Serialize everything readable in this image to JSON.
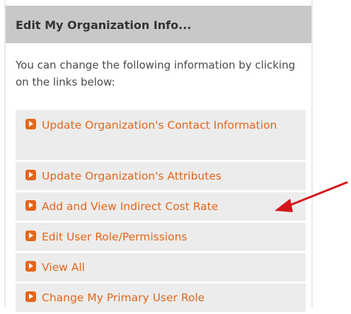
{
  "panel": {
    "title": "Edit My Organization Info...",
    "intro": "You can change the following information by clicking on the links below:"
  },
  "links": [
    {
      "label": "Update Organization's Contact Information",
      "icon": "orange-arrow-bullet-icon"
    },
    {
      "label": "Update Organization's Attributes",
      "icon": "orange-arrow-bullet-icon"
    },
    {
      "label": "Add and View Indirect Cost Rate",
      "icon": "orange-arrow-bullet-icon"
    },
    {
      "label": "Edit User Role/Permissions",
      "icon": "orange-arrow-bullet-icon"
    },
    {
      "label": "View All",
      "icon": "orange-arrow-bullet-icon"
    },
    {
      "label": "Change My Primary User Role",
      "icon": "orange-arrow-bullet-icon"
    }
  ],
  "colors": {
    "link": "#e4661a",
    "header_bg": "#c8c8c8",
    "item_bg": "#ececec",
    "annotation_arrow": "#d4161c"
  }
}
